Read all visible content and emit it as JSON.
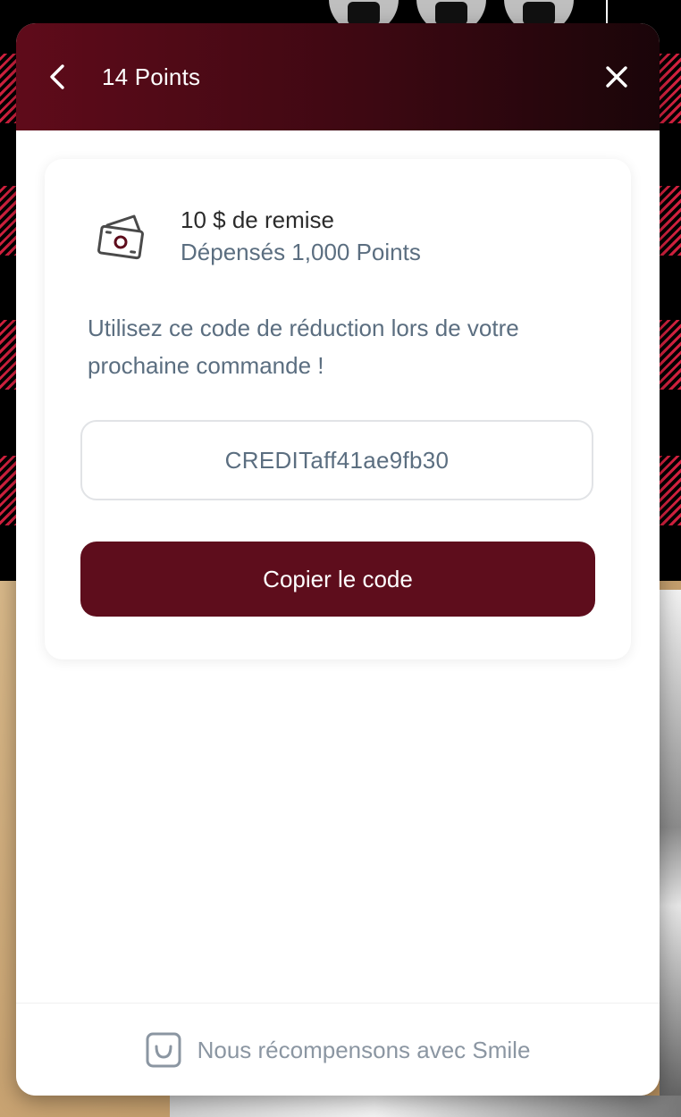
{
  "header": {
    "title": "14 Points",
    "back_icon": "chevron-left-icon",
    "close_icon": "close-icon"
  },
  "reward": {
    "icon": "cash-icon",
    "title": "10 $ de remise",
    "subtitle": "Dépensés 1,000 Points"
  },
  "instructions": "Utilisez ce code de réduction lors de votre prochaine commande !",
  "coupon": {
    "code": "CREDITaff41ae9fb30"
  },
  "copy_button": {
    "label": "Copier le code"
  },
  "footer": {
    "icon": "smile-icon",
    "text": "Nous récompensons avec Smile"
  },
  "colors": {
    "brand": "#5e0d1c",
    "header_gradient_start": "#5f0b1a",
    "header_gradient_end": "#1a0509",
    "muted_text": "#5b6e80",
    "footer_text": "#8b96a2"
  },
  "background": {
    "social_icons": [
      "facebook-icon",
      "youtube-icon",
      "instagram-icon"
    ]
  }
}
